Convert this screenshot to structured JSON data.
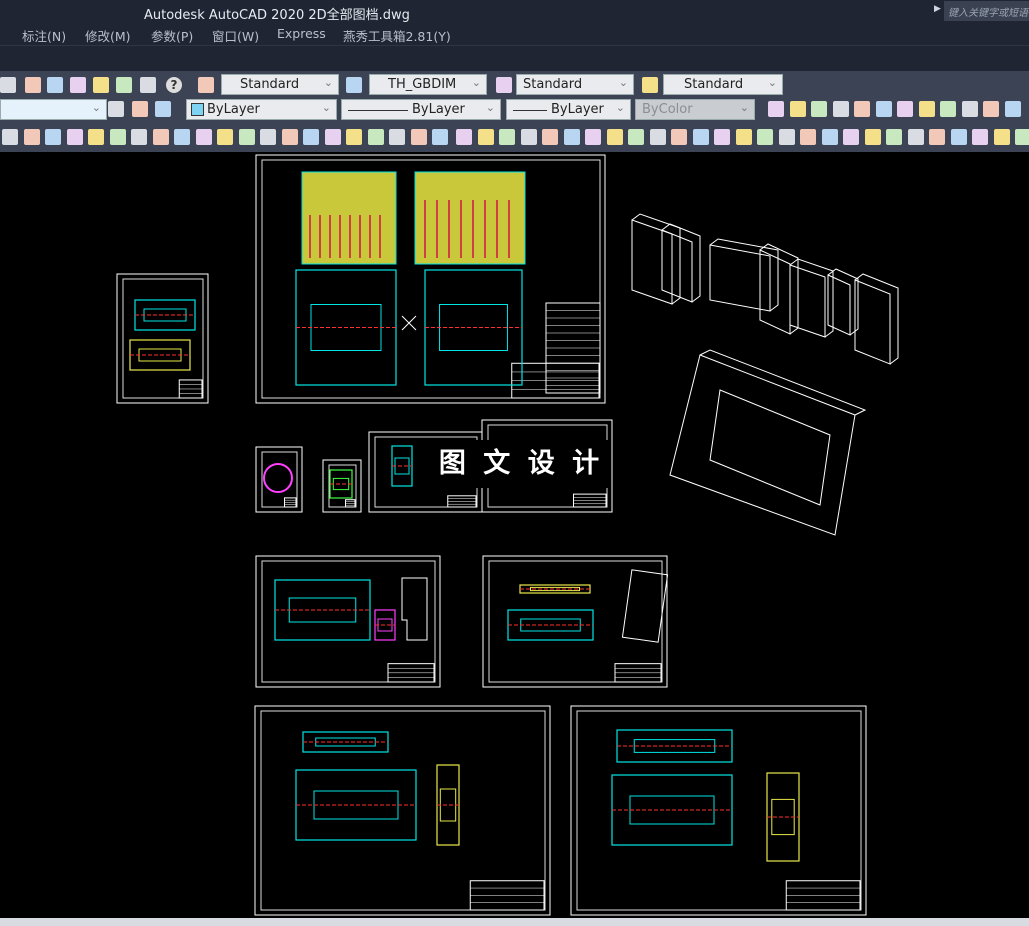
{
  "titlebar": {
    "title": "Autodesk AutoCAD 2020    2D全部图档.dwg",
    "search_placeholder": "键入关键字或短语"
  },
  "menubar": {
    "items": [
      "标注(N)",
      "修改(M)",
      "参数(P)",
      "窗口(W)",
      "Express",
      "燕秀工具箱2.81(Y)"
    ]
  },
  "toolbar": {
    "text_style": "Standard",
    "dim_style": "TH_GBDIM",
    "table_style": "Standard",
    "multileader_style": "Standard",
    "layer": "",
    "color": "ByLayer",
    "linetype": "ByLayer",
    "lineweight": "ByLayer",
    "plot_style": "ByColor",
    "help_icon": "?"
  },
  "canvas": {
    "watermark": "图 文 设 计",
    "background": "#000000",
    "frame_color": "#ffffff",
    "accent_colors": [
      "#e8e84a",
      "#00e5e5",
      "#ff3030",
      "#40ff40",
      "#ff40ff"
    ]
  }
}
